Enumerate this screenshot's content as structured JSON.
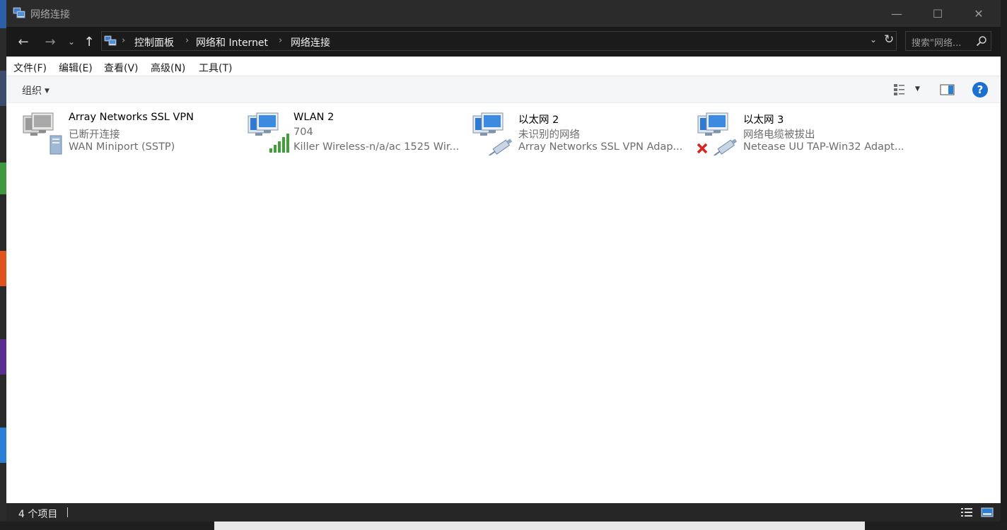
{
  "window": {
    "title": "网络连接",
    "controls": {
      "minimize": "—",
      "maximize": "☐",
      "close": "✕"
    }
  },
  "nav": {
    "back": "←",
    "forward": "→",
    "recent": "⌄",
    "up": "↑",
    "breadcrumb": [
      "控制面板",
      "网络和 Internet",
      "网络连接"
    ],
    "separator": "›",
    "dropdown": "⌄",
    "refresh": "↻",
    "search_placeholder": "搜索\"网络..."
  },
  "menu": [
    "文件(F)",
    "编辑(E)",
    "查看(V)",
    "高级(N)",
    "工具(T)"
  ],
  "command_bar": {
    "organize": "组织",
    "organize_caret": "▼",
    "view_caret": "▼",
    "help": "?"
  },
  "connections": [
    {
      "name": "Array Networks SSL VPN",
      "status": "已断开连接",
      "device": "WAN Miniport (SSTP)",
      "icon": "vpn-connection-icon"
    },
    {
      "name": "WLAN 2",
      "status": "704",
      "device": "Killer Wireless-n/a/ac 1525 Wir...",
      "icon": "wireless-connection-icon"
    },
    {
      "name": "以太网 2",
      "status": "未识别的网络",
      "device": "Array Networks SSL VPN Adap...",
      "icon": "ethernet-connection-icon"
    },
    {
      "name": "以太网 3",
      "status": "网络电缆被拔出",
      "device": "Netease UU TAP-Win32 Adapt...",
      "icon": "ethernet-disconnected-icon"
    }
  ],
  "status_bar": {
    "count": "4 个项目"
  },
  "colors": {
    "titlebar": "#2b2b2b",
    "navbar": "#191919",
    "commandbar": "#f5f6f7",
    "statusbar": "#262626",
    "help_blue": "#1a6fd1",
    "signal_green": "#3fa03a",
    "error_red": "#d9231d"
  }
}
